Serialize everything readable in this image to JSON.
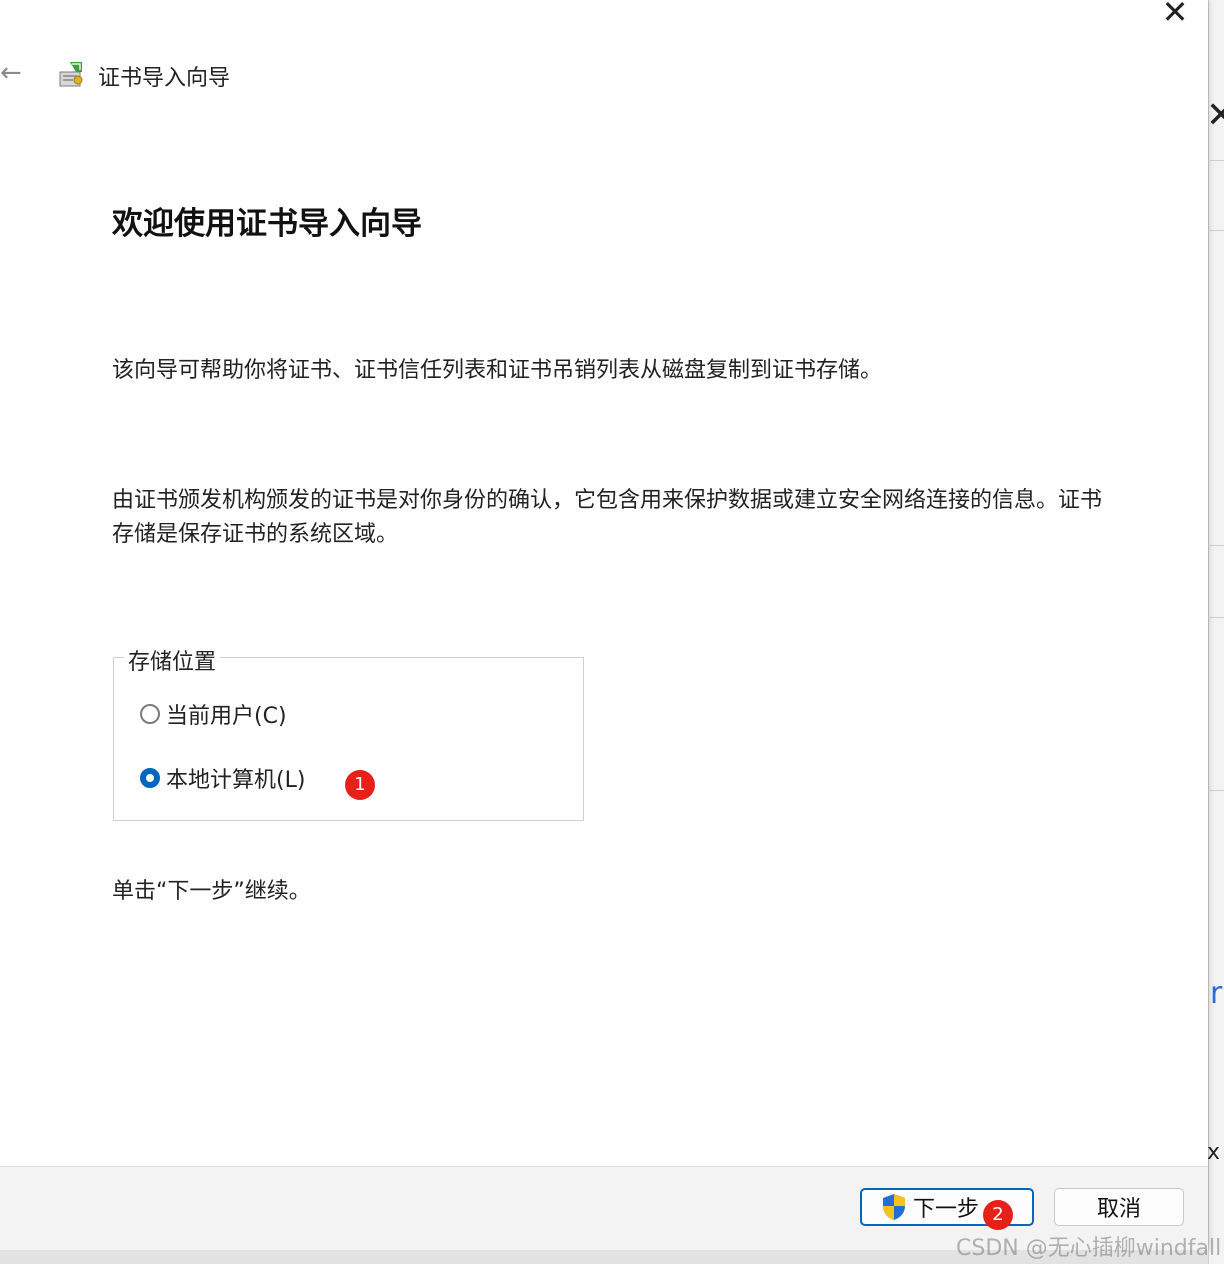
{
  "wizard": {
    "title": "证书导入向导",
    "heading": "欢迎使用证书导入向导",
    "description": "该向导可帮助你将证书、证书信任列表和证书吊销列表从磁盘复制到证书存储。",
    "explanation": "由证书颁发机构颁发的证书是对你身份的确认，它包含用来保护数据或建立安全网络连接的信息。证书存储是保存证书的系统区域。",
    "store_location": {
      "legend": "存储位置",
      "options": [
        {
          "label": "当前用户(C)",
          "selected": false
        },
        {
          "label": "本地计算机(L)",
          "selected": true
        }
      ]
    },
    "hint": "单击“下一步”继续。"
  },
  "footer": {
    "next_label": "下一步",
    "cancel_label": "取消"
  },
  "annotations": {
    "badge_1": "1",
    "badge_2": "2"
  },
  "watermark": "CSDN @无心插柳windfall",
  "colors": {
    "accent": "#0067c0",
    "badge": "#e8201a"
  },
  "icons": [
    "back-arrow-icon",
    "certificate-wizard-icon",
    "close-icon",
    "uac-shield-icon"
  ]
}
